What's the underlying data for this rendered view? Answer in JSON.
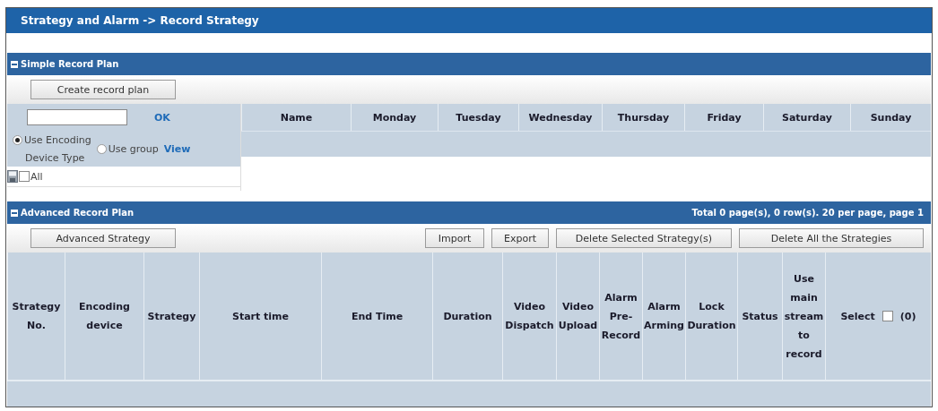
{
  "window": {
    "title": "Strategy and Alarm -> Record Strategy"
  },
  "simple_plan": {
    "title": "Simple Record Plan",
    "expanded": true,
    "create_button": "Create record plan",
    "ok_link": "OK",
    "radios": [
      {
        "label": "Use Encoding",
        "selected": true
      },
      {
        "label": "Use group",
        "selected": false
      }
    ],
    "device_type_label": "Device Type",
    "view_link": "View",
    "all_checkbox": {
      "label": "All",
      "checked": false
    },
    "columns": [
      "Name",
      "Monday",
      "Tuesday",
      "Wednesday",
      "Thursday",
      "Friday",
      "Saturday",
      "Sunday"
    ]
  },
  "advanced_plan": {
    "title": "Advanced Record Plan",
    "expanded": true,
    "pagination": "Total 0 page(s), 0 row(s). 20 per page, page 1",
    "left_button": "Advanced Strategy",
    "right_buttons": [
      "Import",
      "Export",
      "Delete Selected Strategy(s)",
      "Delete All the Strategies"
    ],
    "columns": [
      "Strategy No.",
      "Encoding device",
      "Strategy",
      "Start time",
      "End Time",
      "Duration",
      "Video Dispatch",
      "Video Upload",
      "Alarm Pre-Record",
      "Alarm Arming",
      "Lock Duration",
      "Status",
      "Use main stream to record"
    ],
    "select_header": {
      "label": "Select",
      "checked": false,
      "count": "(0)"
    }
  }
}
